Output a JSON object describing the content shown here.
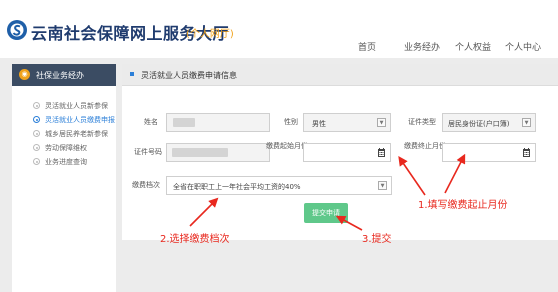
{
  "header": {
    "brand": "云南社会保障网上服务大厅",
    "brand_sub": "(个人网厅)",
    "nav": [
      "首页",
      "业务经办",
      "个人权益",
      "个人中心"
    ]
  },
  "sidebar": {
    "heading": "社保业务经办",
    "items": [
      {
        "label": "灵活就业人员新参保"
      },
      {
        "label": "灵活就业人员缴费申报"
      },
      {
        "label": "城乡居民养老新参保"
      },
      {
        "label": "劳动保障维权"
      },
      {
        "label": "业务进度查询"
      }
    ]
  },
  "form": {
    "title": "灵活就业人员缴费申请信息",
    "name_label": "姓名",
    "gender_label": "性别",
    "gender_value": "男性",
    "id_type_label": "证件类型",
    "id_type_value": "居民身份证(户口簿)",
    "id_no_label": "证件号码",
    "start_month_label": "缴费起始月份",
    "end_month_label": "缴费终止月份",
    "grade_label": "缴费档次",
    "grade_value": "全省在职职工上一年社会平均工资的40%",
    "submit_label": "提交申请"
  },
  "annotations": {
    "step1": "1.填写缴费起止月份",
    "step2": "2.选择缴费档次",
    "step3": "3.提交",
    "color": "#e8281e"
  },
  "colors": {
    "brand": "#1f3b6e",
    "accent_orange": "#f0a21b",
    "sidebar_head": "#3b4c63",
    "active_link": "#2b7fd8",
    "submit_green": "#5fc88a"
  }
}
